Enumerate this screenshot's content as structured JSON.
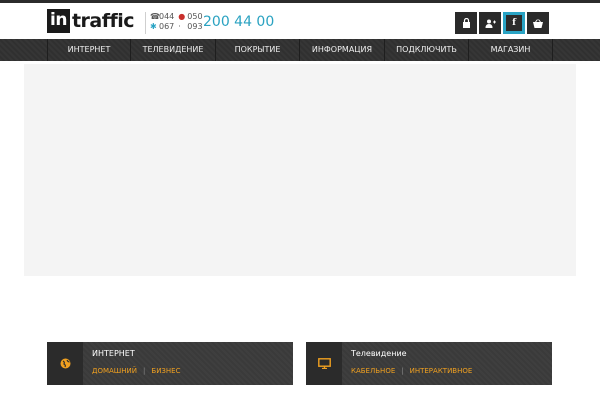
{
  "brand": {
    "logo_in": "in",
    "logo_rest": "traffic"
  },
  "phones": {
    "code1": "044",
    "code2": "050",
    "code3": "067",
    "code4": "093",
    "main": "200 44 00"
  },
  "header_icons": [
    {
      "name": "lock-icon"
    },
    {
      "name": "users-icon"
    },
    {
      "name": "facebook-icon",
      "label": "f"
    },
    {
      "name": "basket-icon"
    }
  ],
  "nav": {
    "items": [
      {
        "label": "ИНТЕРНЕТ",
        "w": 84
      },
      {
        "label": "ТЕЛЕВИДЕНИЕ",
        "w": 85
      },
      {
        "label": "ПОКРЫТИЕ",
        "w": 84
      },
      {
        "label": "ИНФОРМАЦИЯ",
        "w": 85
      },
      {
        "label": "ПОДКЛЮЧИТЬ",
        "w": 84
      },
      {
        "label": "МАГАЗИН",
        "w": 84
      }
    ]
  },
  "cards": [
    {
      "title": "ИНТЕРНЕТ",
      "links": [
        "ДОМАШНИЙ",
        "БИЗНЕС"
      ],
      "icon": "globe-icon"
    },
    {
      "title": "Телевидение",
      "links": [
        "КАБЕЛЬНОЕ",
        "ИНТЕРАКТИВНОЕ"
      ],
      "icon": "tv-icon"
    }
  ],
  "colors": {
    "accent_blue": "#2aa2c1",
    "accent_orange": "#f0a020",
    "nav_bg": "#303030"
  }
}
